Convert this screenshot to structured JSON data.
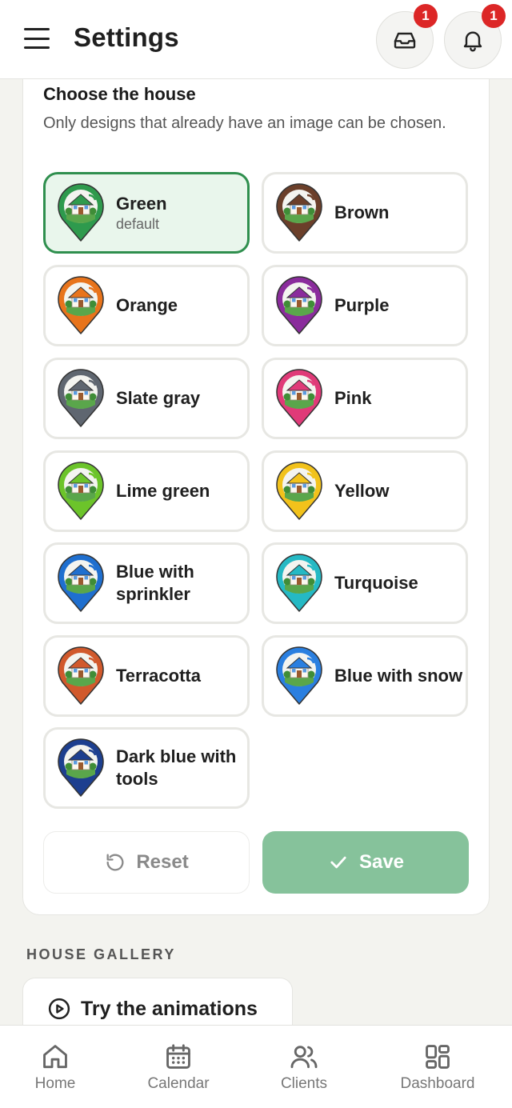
{
  "header": {
    "title": "Settings",
    "inbox_badge": "1",
    "notifications_badge": "1"
  },
  "house": {
    "title": "Choose the house",
    "description": "Only designs that already have an image can be chosen.",
    "options": [
      {
        "name": "Green",
        "sub": "default",
        "color": "#2e9a4d",
        "selected": true
      },
      {
        "name": "Brown",
        "color": "#6b3f2a"
      },
      {
        "name": "Orange",
        "color": "#e8741c"
      },
      {
        "name": "Purple",
        "color": "#8a2c9c"
      },
      {
        "name": "Slate gray",
        "color": "#5f6670"
      },
      {
        "name": "Pink",
        "color": "#e03a78"
      },
      {
        "name": "Lime green",
        "color": "#6cc42a"
      },
      {
        "name": "Yellow",
        "color": "#f2c21b"
      },
      {
        "name": "Blue with sprinkler",
        "color": "#1f6fcf"
      },
      {
        "name": "Turquoise",
        "color": "#25b9c4"
      },
      {
        "name": "Terracotta",
        "color": "#d1592c"
      },
      {
        "name": "Blue with snow",
        "color": "#2a7fe0"
      },
      {
        "name": "Dark blue with tools",
        "color": "#1d3f8f"
      }
    ],
    "reset_label": "Reset",
    "save_label": "Save"
  },
  "gallery": {
    "title": "HOUSE GALLERY",
    "try_label": "Try the animations"
  },
  "nav": {
    "home": "Home",
    "calendar": "Calendar",
    "clients": "Clients",
    "dashboard": "Dashboard"
  }
}
